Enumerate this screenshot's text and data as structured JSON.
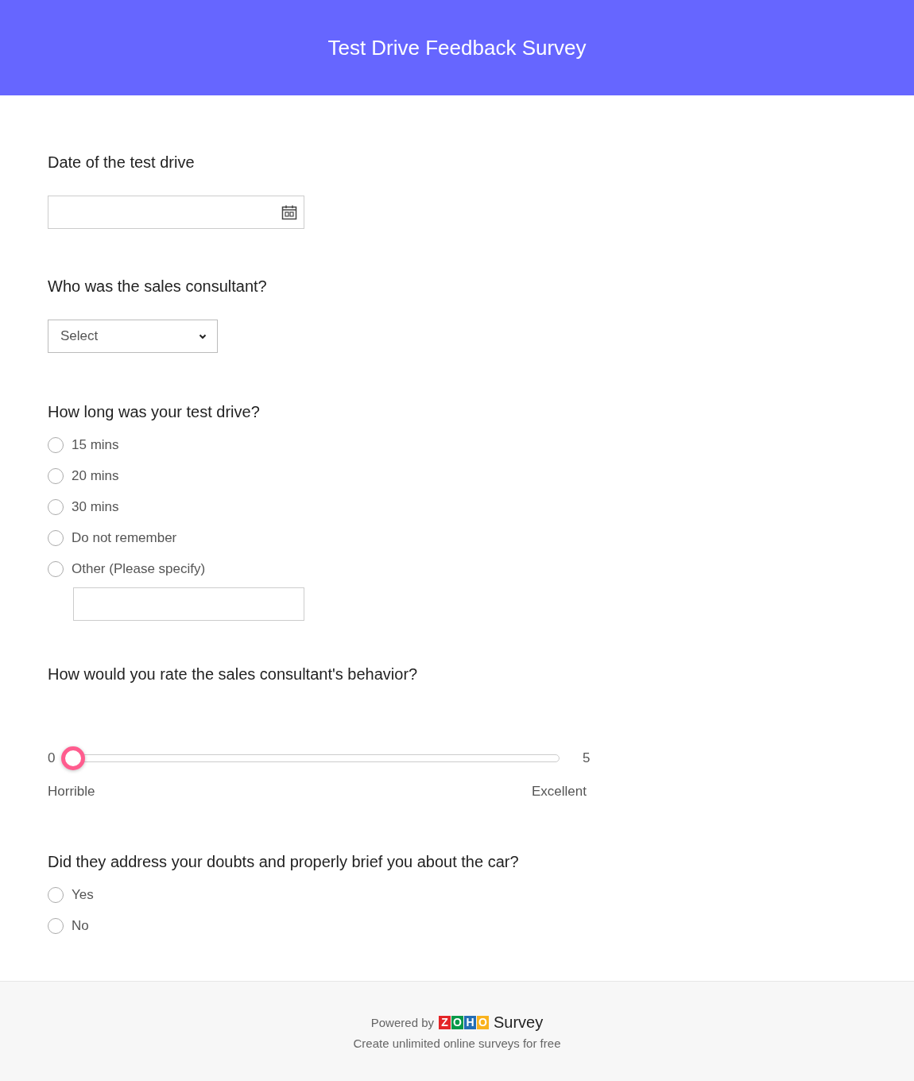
{
  "header": {
    "title": "Test Drive Feedback Survey"
  },
  "questions": [
    {
      "kind": "date",
      "label": "Date of the test drive"
    },
    {
      "kind": "select",
      "label": "Who was the sales consultant?",
      "placeholder": "Select"
    },
    {
      "kind": "radio",
      "label": "How long was your test drive?",
      "options": [
        {
          "label": "15 mins",
          "selected": false
        },
        {
          "label": "20 mins",
          "selected": false
        },
        {
          "label": "30 mins",
          "selected": false
        },
        {
          "label": "Do not remember",
          "selected": false
        },
        {
          "label": "Other (Please specify)",
          "selected": false,
          "has_input": true
        }
      ]
    },
    {
      "kind": "slider",
      "label": "How would you rate the sales consultant's behavior?",
      "min": "0",
      "max": "5",
      "level": 0,
      "min_label": "Horrible",
      "max_label": "Excellent"
    },
    {
      "kind": "radio",
      "label": "Did they address your doubts and properly brief you about the car?",
      "options": [
        {
          "label": "Yes",
          "selected": false
        },
        {
          "label": "No",
          "selected": false
        }
      ]
    }
  ],
  "footer": {
    "powered_by": "Powered by",
    "logo_letters": [
      {
        "letter": "Z",
        "color": "#e42527"
      },
      {
        "letter": "O",
        "color": "#089949"
      },
      {
        "letter": "H",
        "color": "#226db4"
      },
      {
        "letter": "O",
        "color": "#f9b21d"
      }
    ],
    "product": "Survey",
    "tagline": "Create unlimited online surveys for free"
  }
}
